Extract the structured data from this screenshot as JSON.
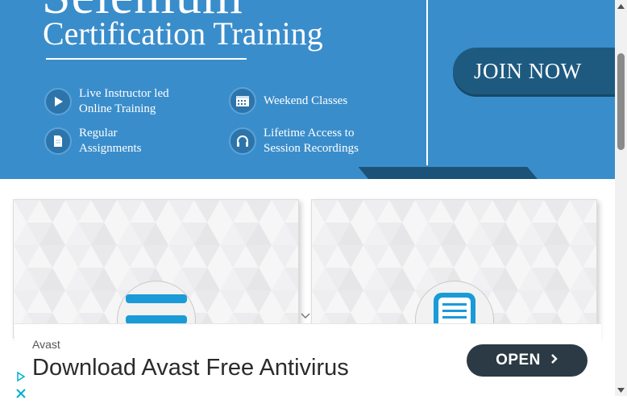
{
  "banner": {
    "title_top": "Selenium",
    "title": "Certification Training",
    "features": [
      {
        "label": "Live Instructor led\nOnline Training",
        "icon": "play-icon"
      },
      {
        "label": "Weekend Classes",
        "icon": "calendar-icon"
      },
      {
        "label": "Regular\nAssignments",
        "icon": "document-icon"
      },
      {
        "label": "Lifetime Access to\nSession Recordings",
        "icon": "headphones-icon"
      }
    ],
    "join_label": "JOIN NOW"
  },
  "colors": {
    "banner_bg": "#3a8dcb",
    "join_button": "#1e5a80",
    "card_icon_blue": "#1a9bd7",
    "ad_button": "#2b3a45"
  },
  "cards": [
    {
      "icon": "menu-lines-icon"
    },
    {
      "icon": "notes-icon"
    }
  ],
  "ad": {
    "brand": "Avast",
    "headline": "Download Avast Free Antivirus",
    "open_label": "OPEN",
    "choices_icons": [
      "adchoices-icon",
      "close-icon"
    ]
  }
}
